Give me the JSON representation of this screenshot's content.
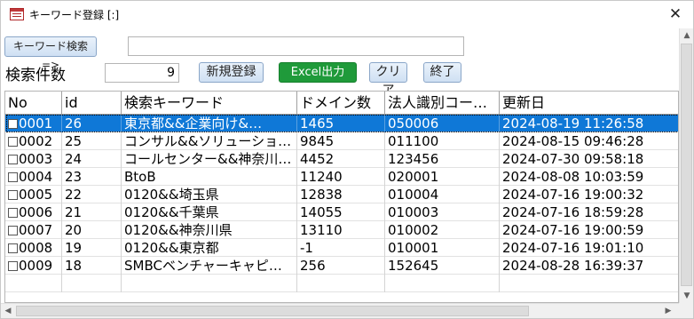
{
  "window": {
    "title": "キーワード登録 [:]",
    "close_glyph": "✕"
  },
  "search": {
    "button_label": "キーワード検索=>",
    "input_value": ""
  },
  "count": {
    "label": "検索件数",
    "value": "9"
  },
  "toolbar": {
    "new_label": "新規登録",
    "excel_label": "Excel出力",
    "clear_label": "クリア",
    "end_label": "終了",
    "excel_color": "#1f9a3a"
  },
  "grid": {
    "columns": [
      "No",
      "id",
      "検索キーワード",
      "ドメイン数",
      "法人識別コー…",
      "更新日"
    ],
    "rows": [
      {
        "no": "0001",
        "id": "26",
        "keyword": "東京都&&企業向け&…",
        "domains": "1465",
        "code": "050006",
        "updated": "2024-08-19 11:26:58"
      },
      {
        "no": "0002",
        "id": "25",
        "keyword": "コンサル&&ソリューショ…",
        "domains": "9845",
        "code": "011100",
        "updated": "2024-08-15 09:46:28"
      },
      {
        "no": "0003",
        "id": "24",
        "keyword": "コールセンター&&神奈川…",
        "domains": "4452",
        "code": "123456",
        "updated": "2024-07-30 09:58:18"
      },
      {
        "no": "0004",
        "id": "23",
        "keyword": "BtoB",
        "domains": "11240",
        "code": "020001",
        "updated": "2024-08-08 10:03:59"
      },
      {
        "no": "0005",
        "id": "22",
        "keyword": "0120&&埼玉県",
        "domains": "12838",
        "code": "010004",
        "updated": "2024-07-16 19:00:32"
      },
      {
        "no": "0006",
        "id": "21",
        "keyword": "0120&&千葉県",
        "domains": "14055",
        "code": "010003",
        "updated": "2024-07-16 18:59:28"
      },
      {
        "no": "0007",
        "id": "20",
        "keyword": "0120&&神奈川県",
        "domains": "13110",
        "code": "010002",
        "updated": "2024-07-16 19:00:59"
      },
      {
        "no": "0008",
        "id": "19",
        "keyword": "0120&&東京都",
        "domains": "-1",
        "code": "010001",
        "updated": "2024-07-16 19:01:10"
      },
      {
        "no": "0009",
        "id": "18",
        "keyword": "SMBCベンチャーキャピ…",
        "domains": "256",
        "code": "152645",
        "updated": "2024-08-28 16:39:37"
      }
    ],
    "selected_color": "#0f78d7"
  },
  "scroll": {
    "up": "▲",
    "down": "▼",
    "left": "◀",
    "right": "▶"
  }
}
